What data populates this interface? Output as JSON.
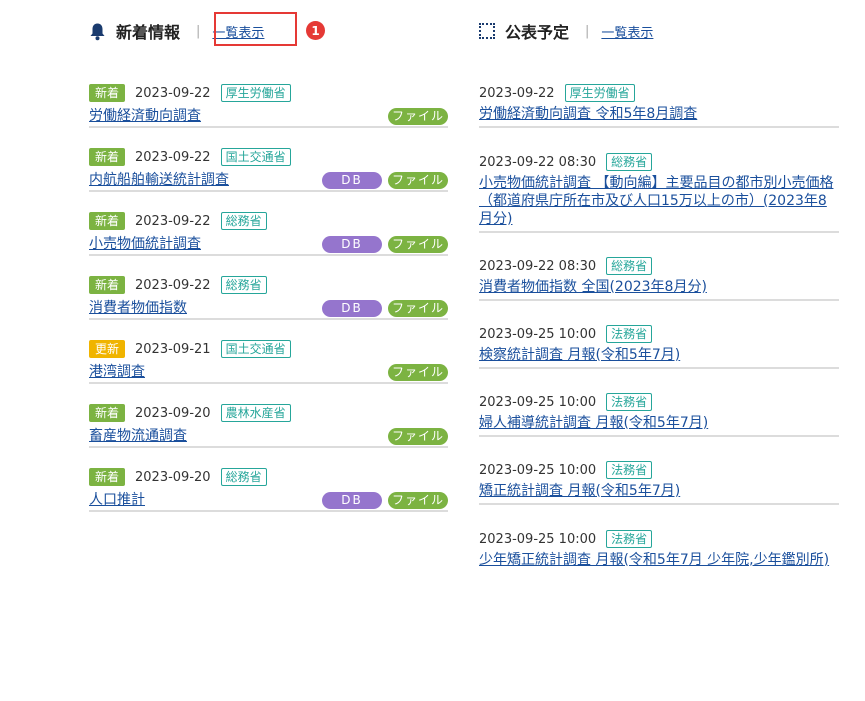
{
  "news": {
    "title": "新着情報",
    "separator": "|",
    "list_link": "一覧表示",
    "callout_number": "1",
    "items": [
      {
        "tag": "新着",
        "date": "2023-09-22",
        "ministry": "厚生労働省",
        "title": "労働経済動向調査",
        "db": false,
        "file": "ファイル"
      },
      {
        "tag": "新着",
        "date": "2023-09-22",
        "ministry": "国土交通省",
        "title": "内航船舶輸送統計調査",
        "db": "DB",
        "file": "ファイル"
      },
      {
        "tag": "新着",
        "date": "2023-09-22",
        "ministry": "総務省",
        "title": "小売物価統計調査",
        "db": "DB",
        "file": "ファイル"
      },
      {
        "tag": "新着",
        "date": "2023-09-22",
        "ministry": "総務省",
        "title": "消費者物価指数",
        "db": "DB",
        "file": "ファイル"
      },
      {
        "tag": "更新",
        "date": "2023-09-21",
        "ministry": "国土交通省",
        "title": "港湾調査",
        "db": false,
        "file": "ファイル"
      },
      {
        "tag": "新着",
        "date": "2023-09-20",
        "ministry": "農林水産省",
        "title": "畜産物流通調査",
        "db": false,
        "file": "ファイル"
      },
      {
        "tag": "新着",
        "date": "2023-09-20",
        "ministry": "総務省",
        "title": "人口推計",
        "db": "DB",
        "file": "ファイル"
      }
    ]
  },
  "schedule": {
    "title": "公表予定",
    "separator": "|",
    "list_link": "一覧表示",
    "items": [
      {
        "date": "2023-09-22",
        "ministry": "厚生労働省",
        "title": "労働経済動向調査 令和5年8月調査"
      },
      {
        "date": "2023-09-22 08:30",
        "ministry": "総務省",
        "title": "小売物価統計調査 【動向編】主要品目の都市別小売価格（都道府県庁所在市及び人口15万以上の市）(2023年8月分)"
      },
      {
        "date": "2023-09-22 08:30",
        "ministry": "総務省",
        "title": "消費者物価指数 全国(2023年8月分)"
      },
      {
        "date": "2023-09-25 10:00",
        "ministry": "法務省",
        "title": "検察統計調査 月報(令和5年7月)"
      },
      {
        "date": "2023-09-25 10:00",
        "ministry": "法務省",
        "title": "婦人補導統計調査 月報(令和5年7月)"
      },
      {
        "date": "2023-09-25 10:00",
        "ministry": "法務省",
        "title": "矯正統計調査 月報(令和5年7月)"
      },
      {
        "date": "2023-09-25 10:00",
        "ministry": "法務省",
        "title": "少年矯正統計調査 月報(令和5年7月 少年院,少年鑑別所)"
      }
    ]
  },
  "colors": {
    "link": "#1a4f9c",
    "new_tag": "#7cb342",
    "update_tag": "#f0b400",
    "ministry": "#26a69a",
    "db_badge": "#9575cd",
    "file_badge": "#7cb342",
    "callout": "#e53935"
  }
}
